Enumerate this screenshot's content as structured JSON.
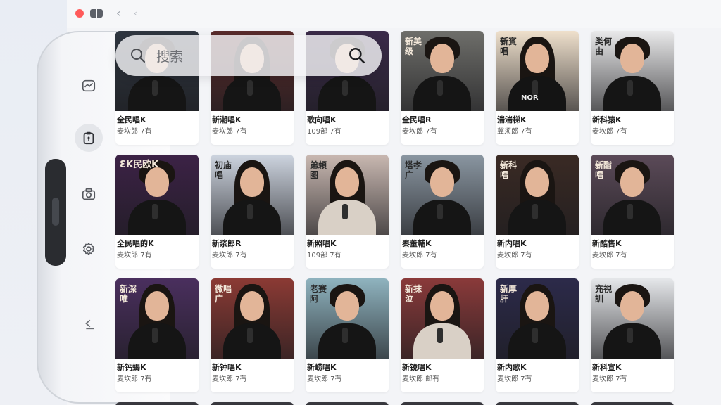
{
  "search": {
    "placeholder": "搜索"
  },
  "sidebar": {
    "items": [
      {
        "icon": "trend-icon"
      },
      {
        "icon": "clipboard-icon"
      },
      {
        "icon": "camera-icon"
      },
      {
        "icon": "gear-icon"
      },
      {
        "icon": "back-arrow-icon"
      }
    ]
  },
  "cards": [
    {
      "title": "全民唱K",
      "meta": "麦坎郎 7有",
      "sign": "",
      "bg": "#2f3640"
    },
    {
      "title": "新潮唱K",
      "meta": "麦坎郎 7有",
      "sign": "",
      "bg": "#5a2b2b"
    },
    {
      "title": "歌向唱K",
      "meta": "109部 7有",
      "sign": "",
      "bg": "#3b2b4a"
    },
    {
      "title": "全民唱R",
      "meta": "麦坎郎 7有",
      "sign": "新美级",
      "bg": "#6e6e6a"
    },
    {
      "title": "湍湍梯K",
      "meta": "冀须郎 7有",
      "sign": "新賓唱",
      "bg": "#efe0cc",
      "shirt": "NOR"
    },
    {
      "title": "新科猿K",
      "meta": "麦坎郎 7有",
      "sign": "类何由",
      "bg": "#e9e9ea"
    },
    {
      "title": "全民唱的K",
      "meta": "麦坎郎 7有",
      "sign": "ƐK民欧K",
      "bg": "#3c2246"
    },
    {
      "title": "新浆郎R",
      "meta": "麦坎郎 7有",
      "sign": "初庙唱",
      "bg": "#cdd4df"
    },
    {
      "title": "新照唱K",
      "meta": "109部 7有",
      "sign": "弟頼图",
      "bg": "#c9b8b1"
    },
    {
      "title": "秦董輔K",
      "meta": "麦坎郎 7有",
      "sign": "塔孝广",
      "bg": "#8a96a1"
    },
    {
      "title": "新内唱K",
      "meta": "麦坎郎 7有",
      "sign": "新科唱",
      "bg": "#3a2a24"
    },
    {
      "title": "新酷售K",
      "meta": "麦坎郎 7有",
      "sign": "新酯唱",
      "bg": "#5b4a58"
    },
    {
      "title": "新钙蝎K",
      "meta": "麦坎郎 7有",
      "sign": "新深唯",
      "bg": "#4a2f5e"
    },
    {
      "title": "新钟唱K",
      "meta": "麦坎郎 7有",
      "sign": "微唱广",
      "bg": "#8b3a34"
    },
    {
      "title": "新崂唱K",
      "meta": "麦坎郎 7有",
      "sign": "老赛阿",
      "bg": "#8fb3bf"
    },
    {
      "title": "新镜唱K",
      "meta": "麦坎郎 邮有",
      "sign": "新抹泣",
      "bg": "#8a3a3a"
    },
    {
      "title": "新内歌K",
      "meta": "麦坎郎 7有",
      "sign": "新厚肝",
      "bg": "#2c2a4a"
    },
    {
      "title": "新科宣K",
      "meta": "麦坎郎 7有",
      "sign": "充視訓",
      "bg": "#e5e7ea"
    }
  ]
}
